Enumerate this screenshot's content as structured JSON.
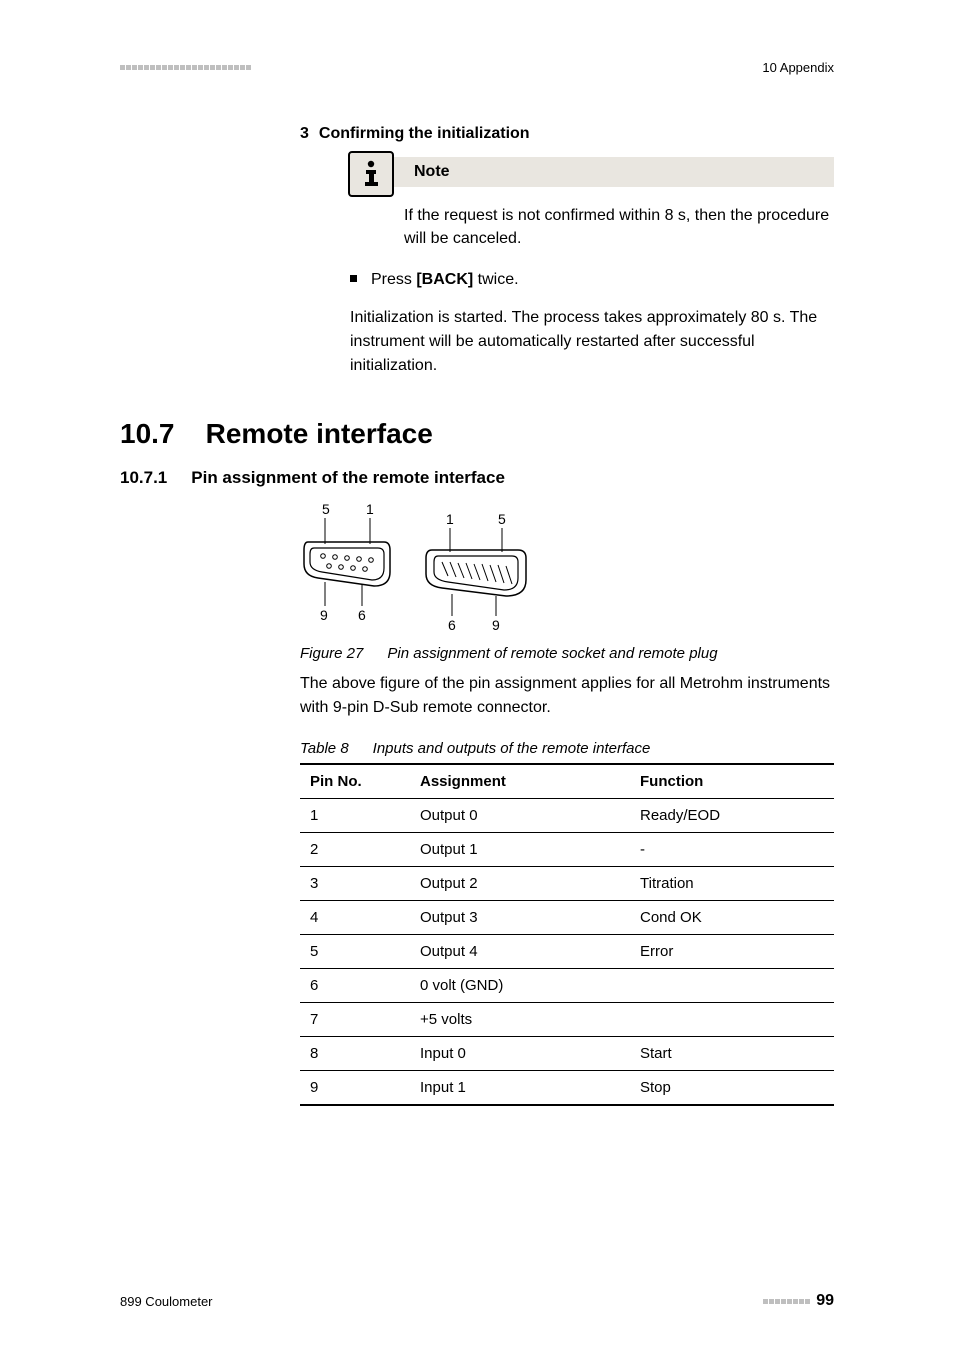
{
  "header": {
    "section_path": "10 Appendix"
  },
  "step": {
    "num": "3",
    "title": "Confirming the initialization"
  },
  "note": {
    "label": "Note",
    "text": "If the request is not confirmed within 8 s, then the procedure will be canceled."
  },
  "bullet": {
    "prefix": "Press ",
    "bold": "[BACK]",
    "suffix": " twice."
  },
  "step_para": "Initialization is started. The process takes approximately 80 s. The instrument will be automatically restarted after successful initialization.",
  "section": {
    "num": "10.7",
    "title": "Remote interface"
  },
  "subsection": {
    "num": "10.7.1",
    "title": "Pin assignment of the remote interface"
  },
  "figure": {
    "label": "Figure 27",
    "caption": "Pin assignment of remote socket and remote plug",
    "pins": {
      "a": "5",
      "b": "1",
      "c": "1",
      "d": "5",
      "e": "9",
      "f": "6",
      "g": "6",
      "h": "9"
    }
  },
  "body_para": "The above figure of the pin assignment applies for all Metrohm instruments with 9-pin D-Sub remote connector.",
  "table": {
    "label": "Table 8",
    "caption": "Inputs and outputs of the remote interface",
    "headers": [
      "Pin No.",
      "Assignment",
      "Function"
    ],
    "rows": [
      {
        "pin": "1",
        "assign": "Output 0",
        "func": "Ready/EOD"
      },
      {
        "pin": "2",
        "assign": "Output 1",
        "func": "-"
      },
      {
        "pin": "3",
        "assign": "Output 2",
        "func": "Titration"
      },
      {
        "pin": "4",
        "assign": "Output 3",
        "func": "Cond OK"
      },
      {
        "pin": "5",
        "assign": "Output 4",
        "func": "Error"
      },
      {
        "pin": "6",
        "assign": "0 volt (GND)",
        "func": ""
      },
      {
        "pin": "7",
        "assign": "+5 volts",
        "func": ""
      },
      {
        "pin": "8",
        "assign": "Input 0",
        "func": "Start"
      },
      {
        "pin": "9",
        "assign": "Input 1",
        "func": "Stop"
      }
    ]
  },
  "footer": {
    "product": "899 Coulometer",
    "page": "99"
  }
}
